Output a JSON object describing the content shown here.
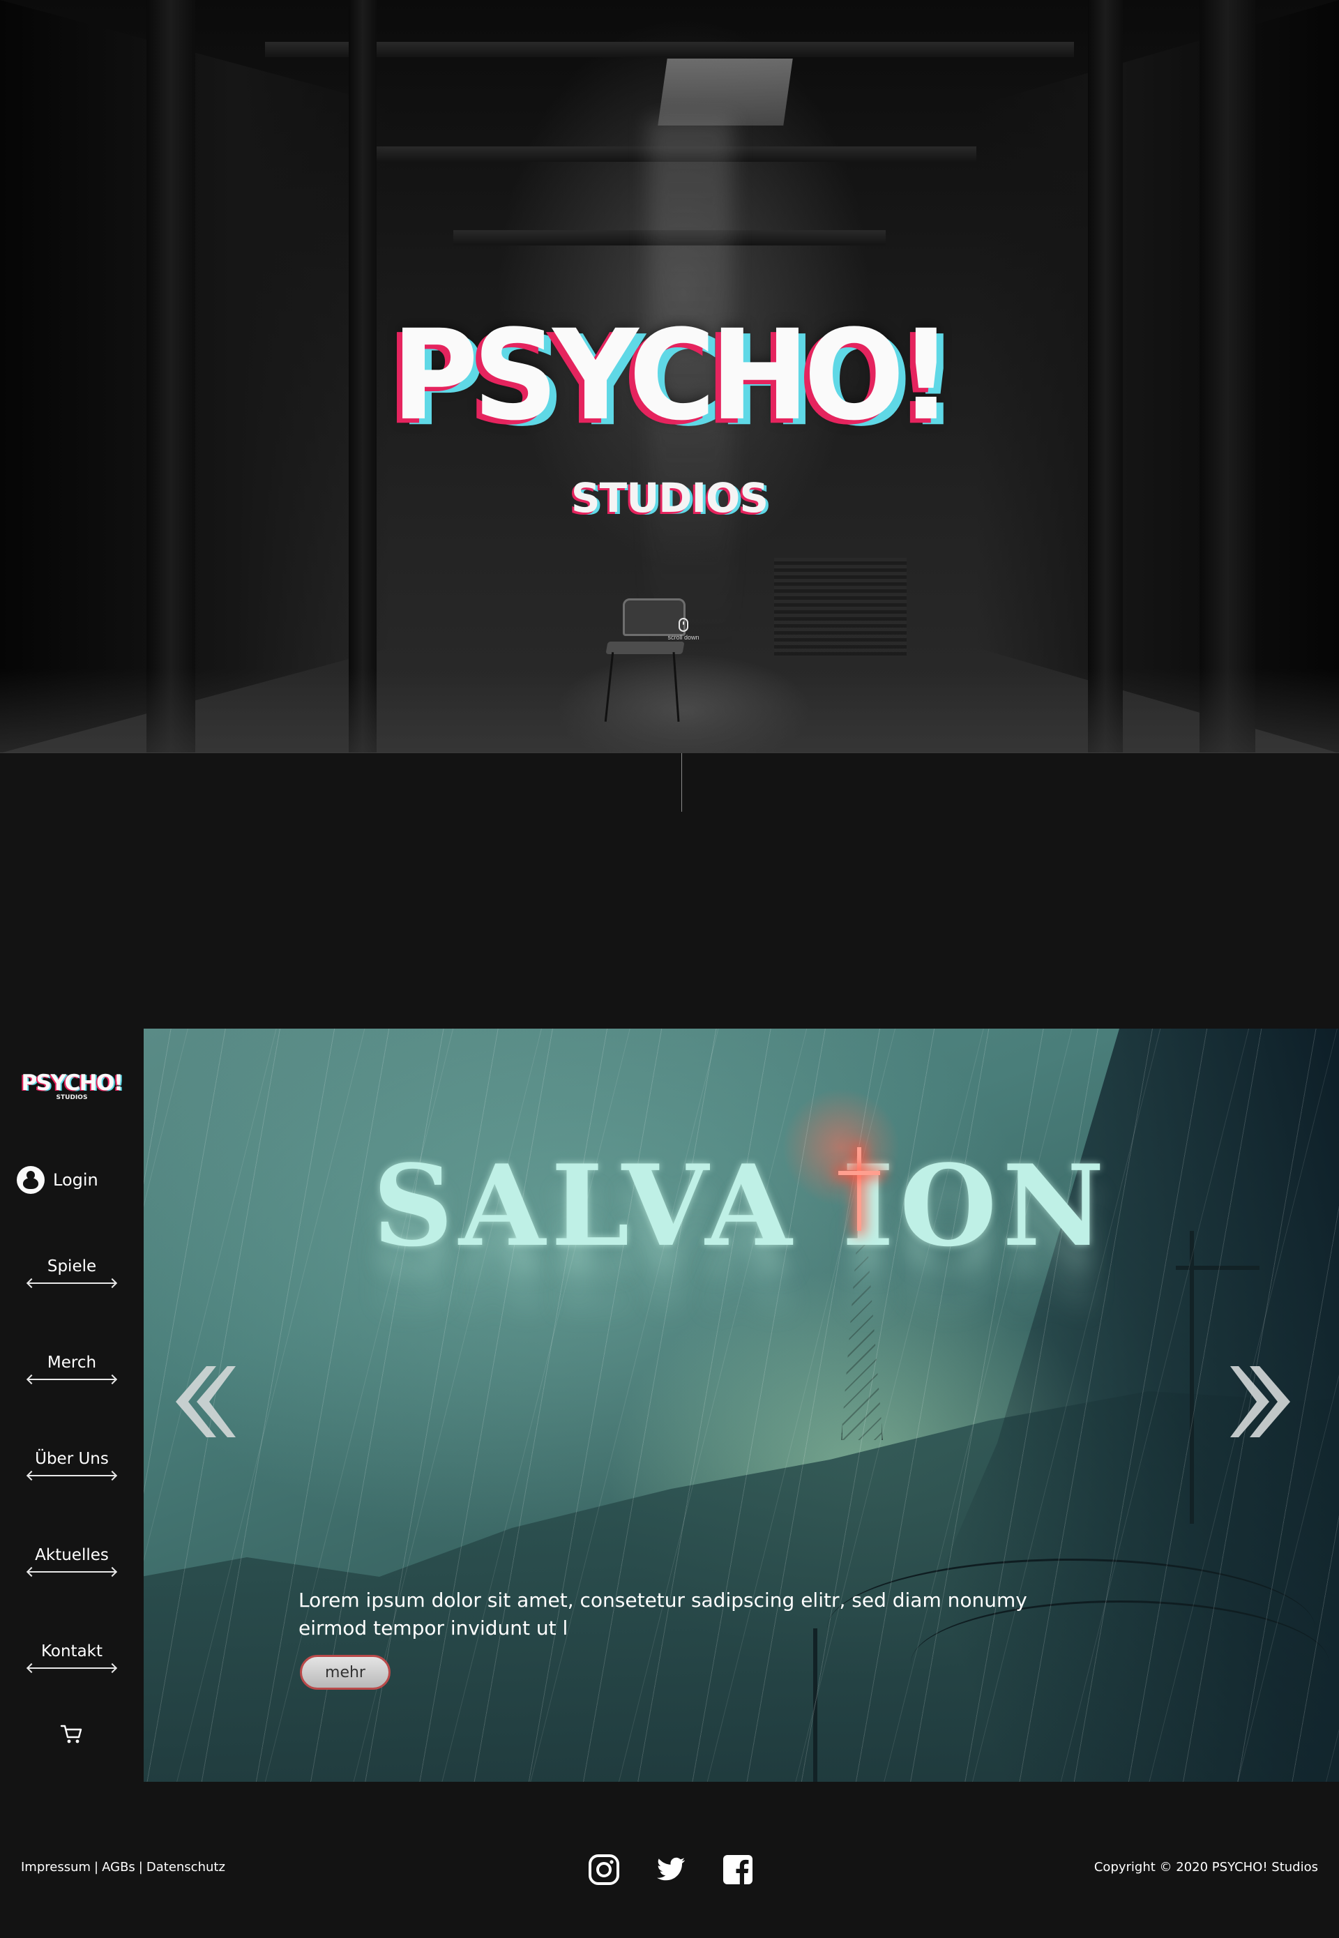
{
  "hero": {
    "title": "PSYCHO!",
    "subtitle": "STUDIOS",
    "scroll_hint": "scroll down",
    "scroll_icon": "mouse-icon"
  },
  "sidebar": {
    "logo": {
      "line1": "PSYCHO!",
      "line2": "STUDIOS"
    },
    "login": {
      "label": "Login",
      "icon": "user-icon"
    },
    "nav": [
      {
        "label": "Spiele"
      },
      {
        "label": "Merch"
      },
      {
        "label": "Über Uns"
      },
      {
        "label": "Aktuelles"
      },
      {
        "label": "Kontakt"
      }
    ],
    "cart_icon": "cart-icon"
  },
  "slider": {
    "title": "SALVA ION",
    "text": "Lorem ipsum dolor sit amet, consetetur sadipscing elitr, sed diam nonumy eirmod tempor invidunt ut l",
    "button": "mehr",
    "prev_icon": "chevron-double-left-icon",
    "next_icon": "chevron-double-right-icon"
  },
  "footer": {
    "links": [
      "Impressum",
      "AGBs",
      "Datenschutz"
    ],
    "social": [
      "instagram-icon",
      "twitter-icon",
      "facebook-icon"
    ],
    "copyright": "Copyright © 2020 PSYCHO! Studios"
  },
  "colors": {
    "background": "#131313",
    "glitch_red": "#e5245e",
    "glitch_cyan": "#5fd8e6",
    "button_border": "#b94a4a"
  }
}
